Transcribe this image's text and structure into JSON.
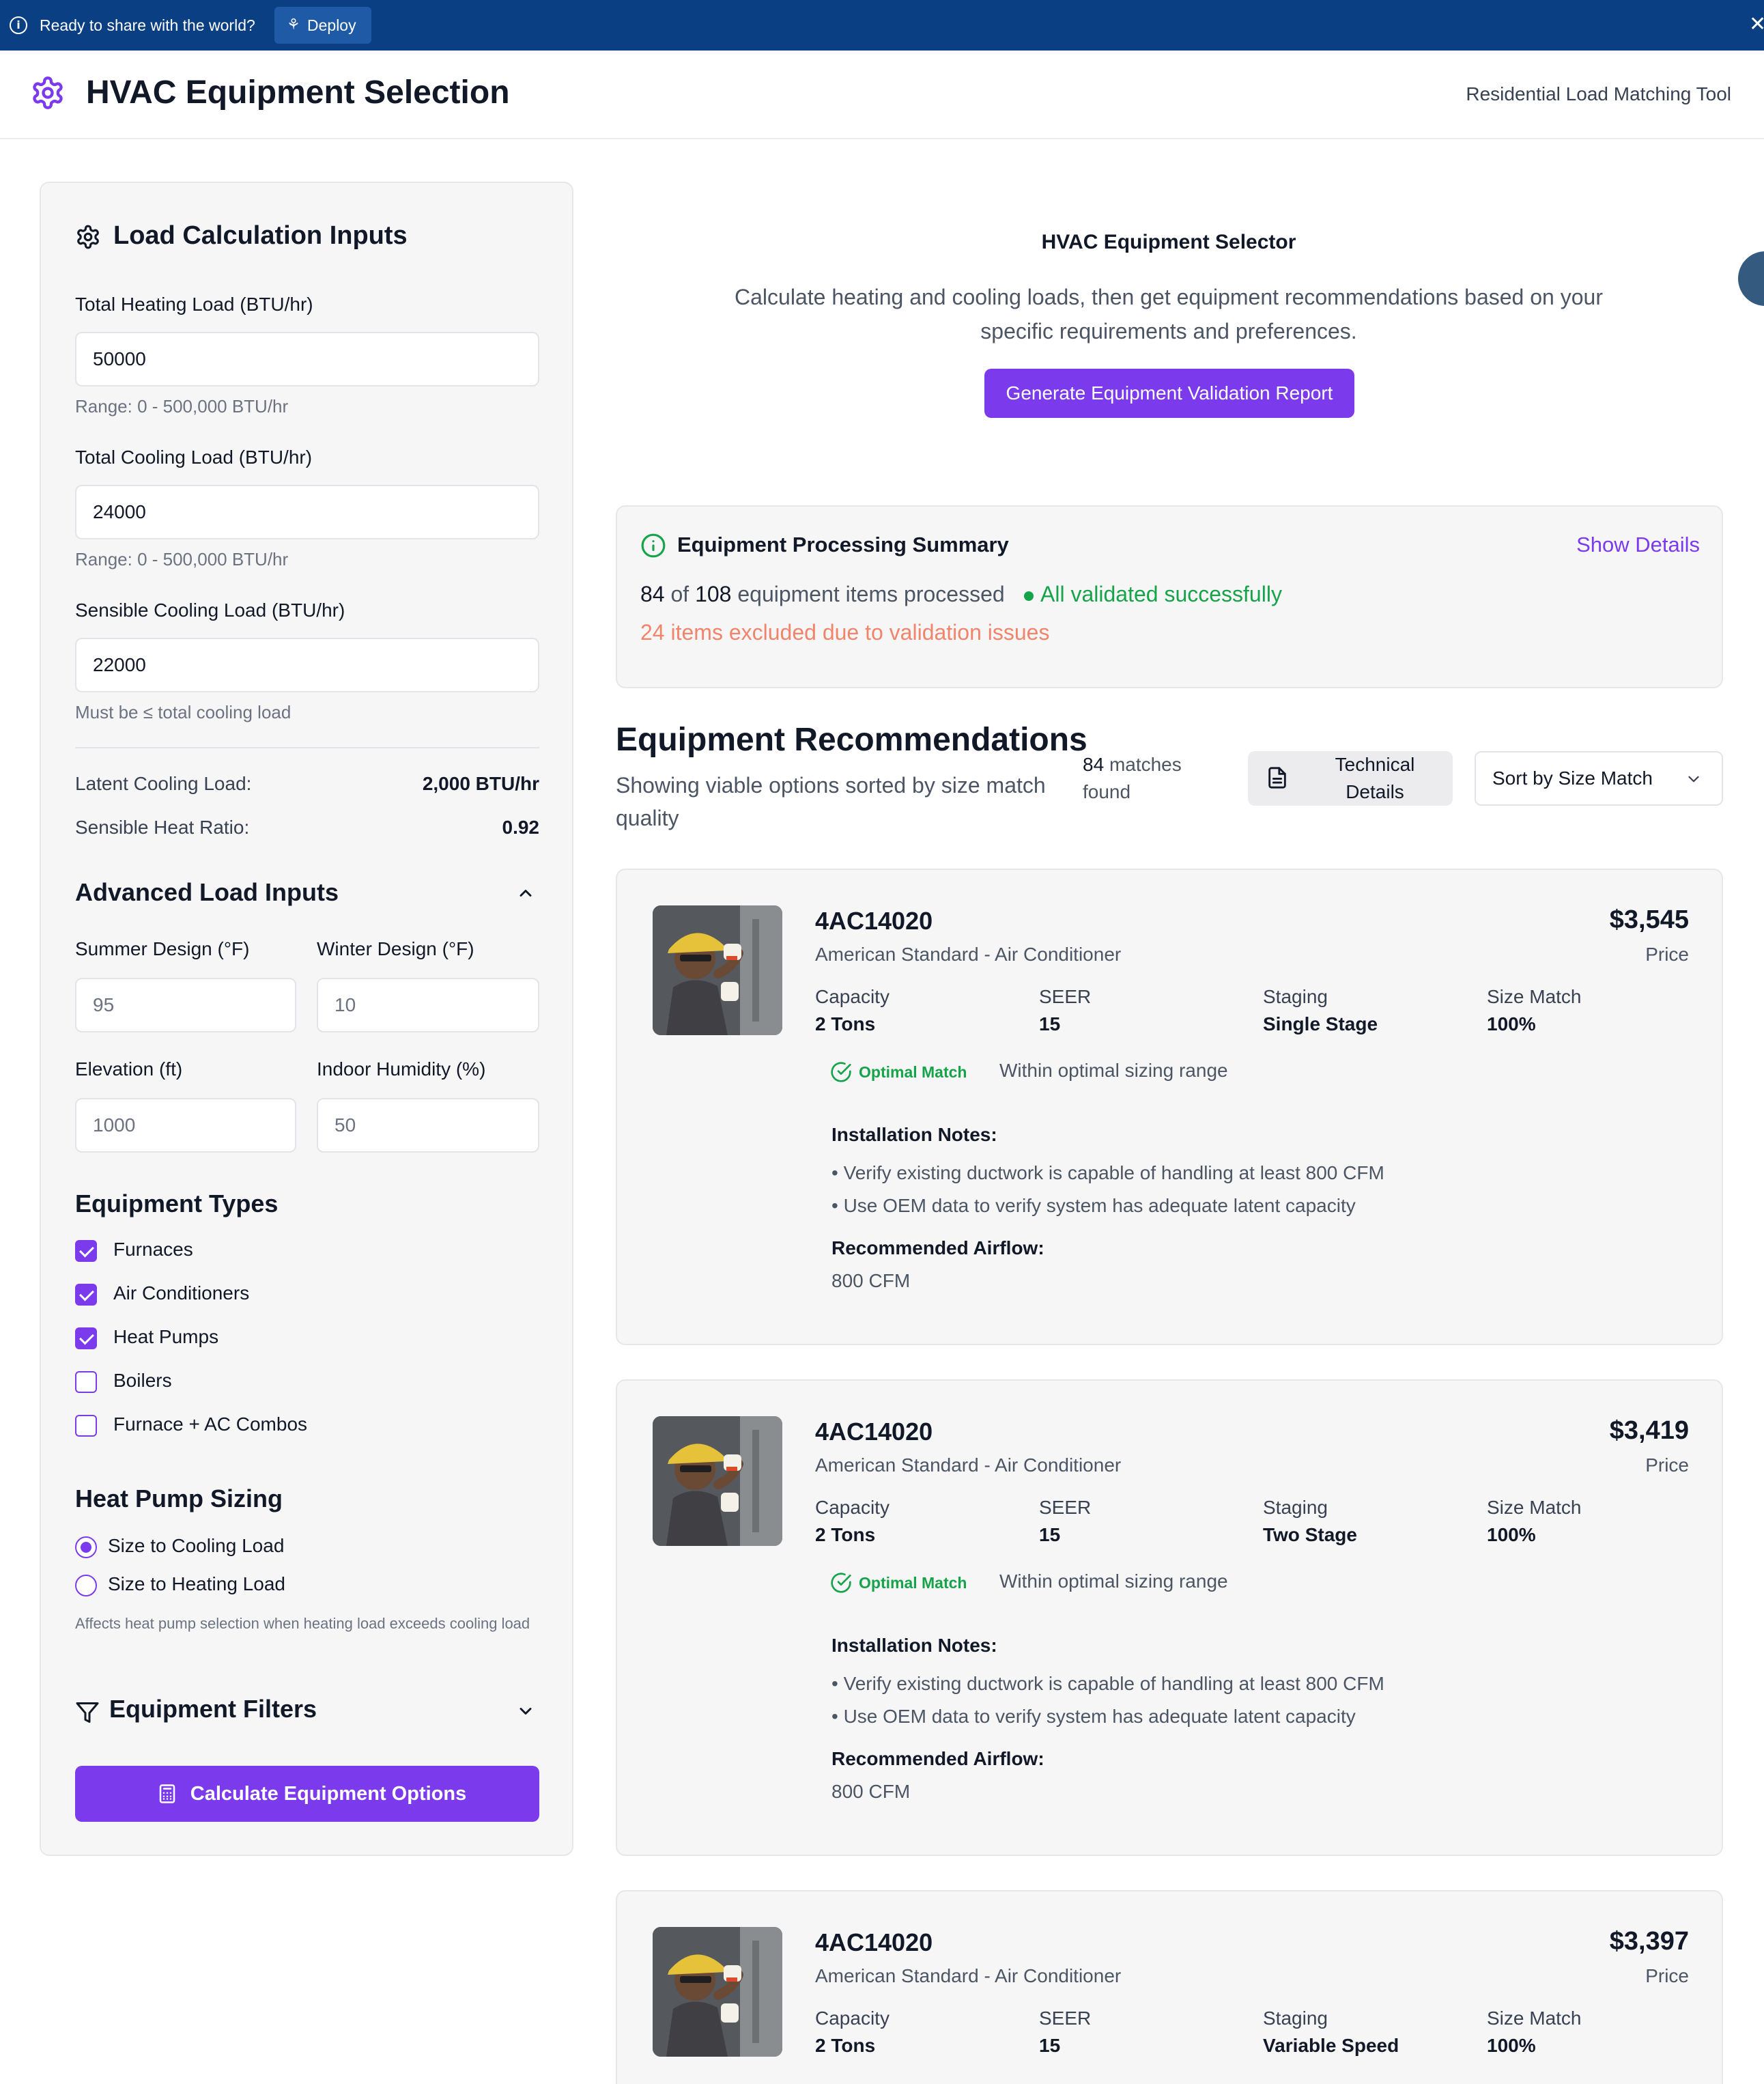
{
  "banner": {
    "message": "Ready to share with the world?",
    "deploy_label": "Deploy"
  },
  "header": {
    "title": "HVAC Equipment Selection",
    "subtitle": "Residential Load Matching Tool"
  },
  "sidebar": {
    "title": "Load Calculation Inputs",
    "heating": {
      "label": "Total Heating Load (BTU/hr)",
      "value": "50000",
      "hint": "Range: 0 - 500,000 BTU/hr"
    },
    "cooling": {
      "label": "Total Cooling Load (BTU/hr)",
      "value": "24000",
      "hint": "Range: 0 - 500,000 BTU/hr"
    },
    "sensible": {
      "label": "Sensible Cooling Load (BTU/hr)",
      "value": "22000",
      "hint": "Must be ≤ total cooling load"
    },
    "latent": {
      "label": "Latent Cooling Load:",
      "value": "2,000 BTU/hr"
    },
    "shr": {
      "label": "Sensible Heat Ratio:",
      "value": "0.92"
    },
    "advanced": {
      "title": "Advanced Load Inputs",
      "summer": {
        "label": "Summer Design (°F)",
        "placeholder": "95"
      },
      "winter": {
        "label": "Winter Design (°F)",
        "placeholder": "10"
      },
      "elevation": {
        "label": "Elevation (ft)",
        "placeholder": "1000"
      },
      "humidity": {
        "label": "Indoor Humidity (%)",
        "placeholder": "50"
      }
    },
    "equipment_types": {
      "title": "Equipment Types",
      "items": [
        {
          "label": "Furnaces",
          "checked": true
        },
        {
          "label": "Air Conditioners",
          "checked": true
        },
        {
          "label": "Heat Pumps",
          "checked": true
        },
        {
          "label": "Boilers",
          "checked": false
        },
        {
          "label": "Furnace + AC Combos",
          "checked": false
        }
      ]
    },
    "heat_pump": {
      "title": "Heat Pump Sizing",
      "options": [
        {
          "label": "Size to Cooling Load",
          "selected": true
        },
        {
          "label": "Size to Heating Load",
          "selected": false
        }
      ],
      "hint": "Affects heat pump selection when heating load exceeds cooling load"
    },
    "filters_title": "Equipment Filters",
    "calc_button": "Calculate Equipment Options"
  },
  "main": {
    "title": "HVAC Equipment Selector",
    "description": "Calculate heating and cooling loads, then get equipment recommendations based on your specific requirements and preferences.",
    "report_button": "Generate Equipment Validation Report"
  },
  "summary": {
    "title": "Equipment Processing Summary",
    "show_details": "Show Details",
    "processed_count": "84",
    "of_text": "of",
    "total_count": "108",
    "processed_suffix": "equipment items processed",
    "validated": "All validated successfully",
    "excluded": "24 items excluded due to validation issues"
  },
  "recommendations": {
    "title": "Equipment Recommendations",
    "subtitle": "Showing viable options sorted by size match quality",
    "matches_count": "84",
    "matches_text": "matches found",
    "tech_button": "Technical Details",
    "sort_label": "Sort by Size Match",
    "spec_labels": {
      "capacity": "Capacity",
      "seer": "SEER",
      "staging": "Staging",
      "size_match": "Size Match"
    },
    "price_label": "Price",
    "install_title": "Installation Notes:",
    "airflow_title": "Recommended Airflow:",
    "cards": [
      {
        "model": "4AC14020",
        "brand": "American Standard - Air Conditioner",
        "price": "$3,545",
        "capacity": "2 Tons",
        "seer": "15",
        "staging": "Single Stage",
        "size_match": "100%",
        "badge": "Optimal Match",
        "badge_note": "Within optimal sizing range",
        "notes": [
          "• Verify existing ductwork is capable of handling at least 800 CFM",
          "• Use OEM data to verify system has adequate latent capacity"
        ],
        "airflow": "800 CFM"
      },
      {
        "model": "4AC14020",
        "brand": "American Standard - Air Conditioner",
        "price": "$3,419",
        "capacity": "2 Tons",
        "seer": "15",
        "staging": "Two Stage",
        "size_match": "100%",
        "badge": "Optimal Match",
        "badge_note": "Within optimal sizing range",
        "notes": [
          "• Verify existing ductwork is capable of handling at least 800 CFM",
          "• Use OEM data to verify system has adequate latent capacity"
        ],
        "airflow": "800 CFM"
      },
      {
        "model": "4AC14020",
        "brand": "American Standard - Air Conditioner",
        "price": "$3,397",
        "capacity": "2 Tons",
        "seer": "15",
        "staging": "Variable Speed",
        "size_match": "100%"
      }
    ]
  },
  "colors": {
    "accent": "#7c3aed",
    "banner": "#0b3f84",
    "success": "#16a34a",
    "warning": "#f2846b"
  }
}
